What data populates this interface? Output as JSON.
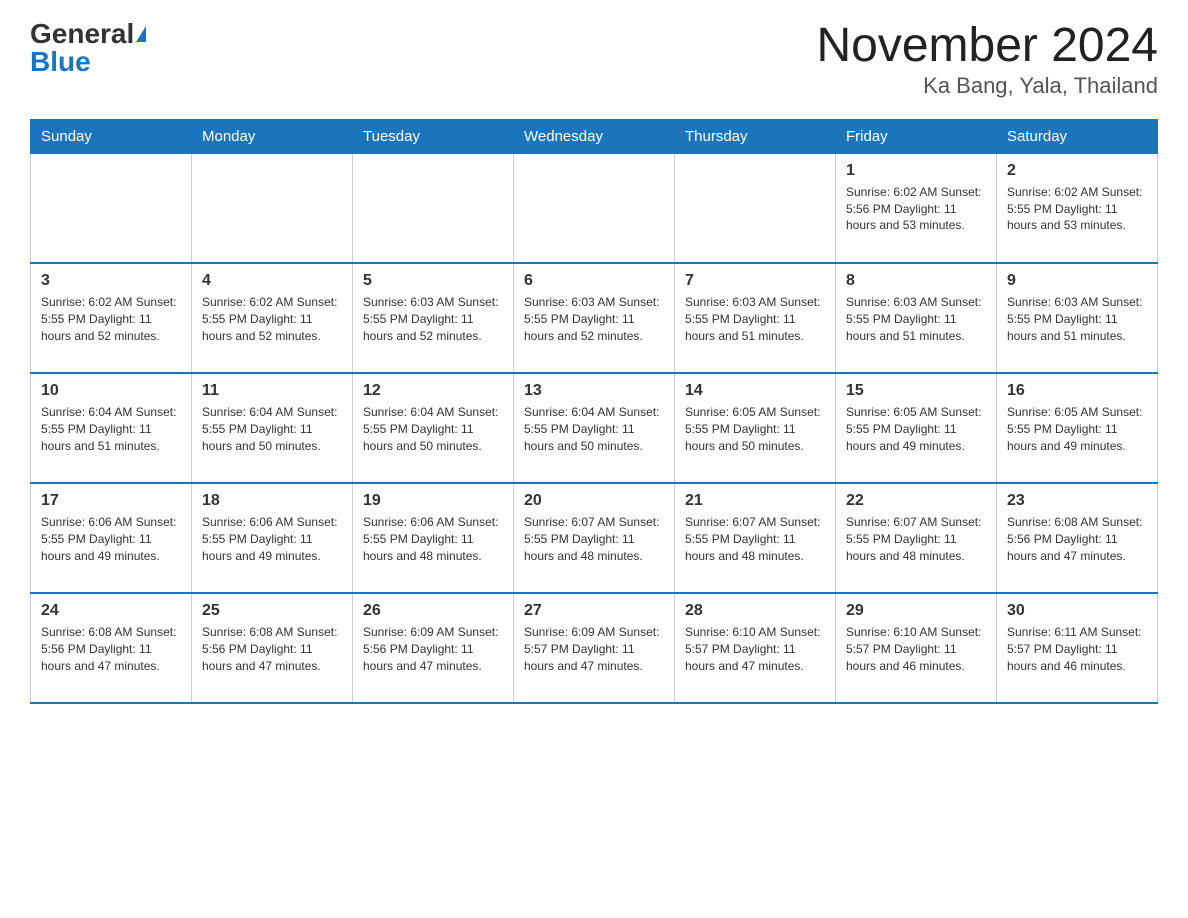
{
  "logo": {
    "general": "General",
    "blue": "Blue"
  },
  "title": "November 2024",
  "subtitle": "Ka Bang, Yala, Thailand",
  "days_of_week": [
    "Sunday",
    "Monday",
    "Tuesday",
    "Wednesday",
    "Thursday",
    "Friday",
    "Saturday"
  ],
  "weeks": [
    [
      {
        "day": "",
        "info": ""
      },
      {
        "day": "",
        "info": ""
      },
      {
        "day": "",
        "info": ""
      },
      {
        "day": "",
        "info": ""
      },
      {
        "day": "",
        "info": ""
      },
      {
        "day": "1",
        "info": "Sunrise: 6:02 AM\nSunset: 5:56 PM\nDaylight: 11 hours and 53 minutes."
      },
      {
        "day": "2",
        "info": "Sunrise: 6:02 AM\nSunset: 5:55 PM\nDaylight: 11 hours and 53 minutes."
      }
    ],
    [
      {
        "day": "3",
        "info": "Sunrise: 6:02 AM\nSunset: 5:55 PM\nDaylight: 11 hours and 52 minutes."
      },
      {
        "day": "4",
        "info": "Sunrise: 6:02 AM\nSunset: 5:55 PM\nDaylight: 11 hours and 52 minutes."
      },
      {
        "day": "5",
        "info": "Sunrise: 6:03 AM\nSunset: 5:55 PM\nDaylight: 11 hours and 52 minutes."
      },
      {
        "day": "6",
        "info": "Sunrise: 6:03 AM\nSunset: 5:55 PM\nDaylight: 11 hours and 52 minutes."
      },
      {
        "day": "7",
        "info": "Sunrise: 6:03 AM\nSunset: 5:55 PM\nDaylight: 11 hours and 51 minutes."
      },
      {
        "day": "8",
        "info": "Sunrise: 6:03 AM\nSunset: 5:55 PM\nDaylight: 11 hours and 51 minutes."
      },
      {
        "day": "9",
        "info": "Sunrise: 6:03 AM\nSunset: 5:55 PM\nDaylight: 11 hours and 51 minutes."
      }
    ],
    [
      {
        "day": "10",
        "info": "Sunrise: 6:04 AM\nSunset: 5:55 PM\nDaylight: 11 hours and 51 minutes."
      },
      {
        "day": "11",
        "info": "Sunrise: 6:04 AM\nSunset: 5:55 PM\nDaylight: 11 hours and 50 minutes."
      },
      {
        "day": "12",
        "info": "Sunrise: 6:04 AM\nSunset: 5:55 PM\nDaylight: 11 hours and 50 minutes."
      },
      {
        "day": "13",
        "info": "Sunrise: 6:04 AM\nSunset: 5:55 PM\nDaylight: 11 hours and 50 minutes."
      },
      {
        "day": "14",
        "info": "Sunrise: 6:05 AM\nSunset: 5:55 PM\nDaylight: 11 hours and 50 minutes."
      },
      {
        "day": "15",
        "info": "Sunrise: 6:05 AM\nSunset: 5:55 PM\nDaylight: 11 hours and 49 minutes."
      },
      {
        "day": "16",
        "info": "Sunrise: 6:05 AM\nSunset: 5:55 PM\nDaylight: 11 hours and 49 minutes."
      }
    ],
    [
      {
        "day": "17",
        "info": "Sunrise: 6:06 AM\nSunset: 5:55 PM\nDaylight: 11 hours and 49 minutes."
      },
      {
        "day": "18",
        "info": "Sunrise: 6:06 AM\nSunset: 5:55 PM\nDaylight: 11 hours and 49 minutes."
      },
      {
        "day": "19",
        "info": "Sunrise: 6:06 AM\nSunset: 5:55 PM\nDaylight: 11 hours and 48 minutes."
      },
      {
        "day": "20",
        "info": "Sunrise: 6:07 AM\nSunset: 5:55 PM\nDaylight: 11 hours and 48 minutes."
      },
      {
        "day": "21",
        "info": "Sunrise: 6:07 AM\nSunset: 5:55 PM\nDaylight: 11 hours and 48 minutes."
      },
      {
        "day": "22",
        "info": "Sunrise: 6:07 AM\nSunset: 5:55 PM\nDaylight: 11 hours and 48 minutes."
      },
      {
        "day": "23",
        "info": "Sunrise: 6:08 AM\nSunset: 5:56 PM\nDaylight: 11 hours and 47 minutes."
      }
    ],
    [
      {
        "day": "24",
        "info": "Sunrise: 6:08 AM\nSunset: 5:56 PM\nDaylight: 11 hours and 47 minutes."
      },
      {
        "day": "25",
        "info": "Sunrise: 6:08 AM\nSunset: 5:56 PM\nDaylight: 11 hours and 47 minutes."
      },
      {
        "day": "26",
        "info": "Sunrise: 6:09 AM\nSunset: 5:56 PM\nDaylight: 11 hours and 47 minutes."
      },
      {
        "day": "27",
        "info": "Sunrise: 6:09 AM\nSunset: 5:57 PM\nDaylight: 11 hours and 47 minutes."
      },
      {
        "day": "28",
        "info": "Sunrise: 6:10 AM\nSunset: 5:57 PM\nDaylight: 11 hours and 47 minutes."
      },
      {
        "day": "29",
        "info": "Sunrise: 6:10 AM\nSunset: 5:57 PM\nDaylight: 11 hours and 46 minutes."
      },
      {
        "day": "30",
        "info": "Sunrise: 6:11 AM\nSunset: 5:57 PM\nDaylight: 11 hours and 46 minutes."
      }
    ]
  ]
}
